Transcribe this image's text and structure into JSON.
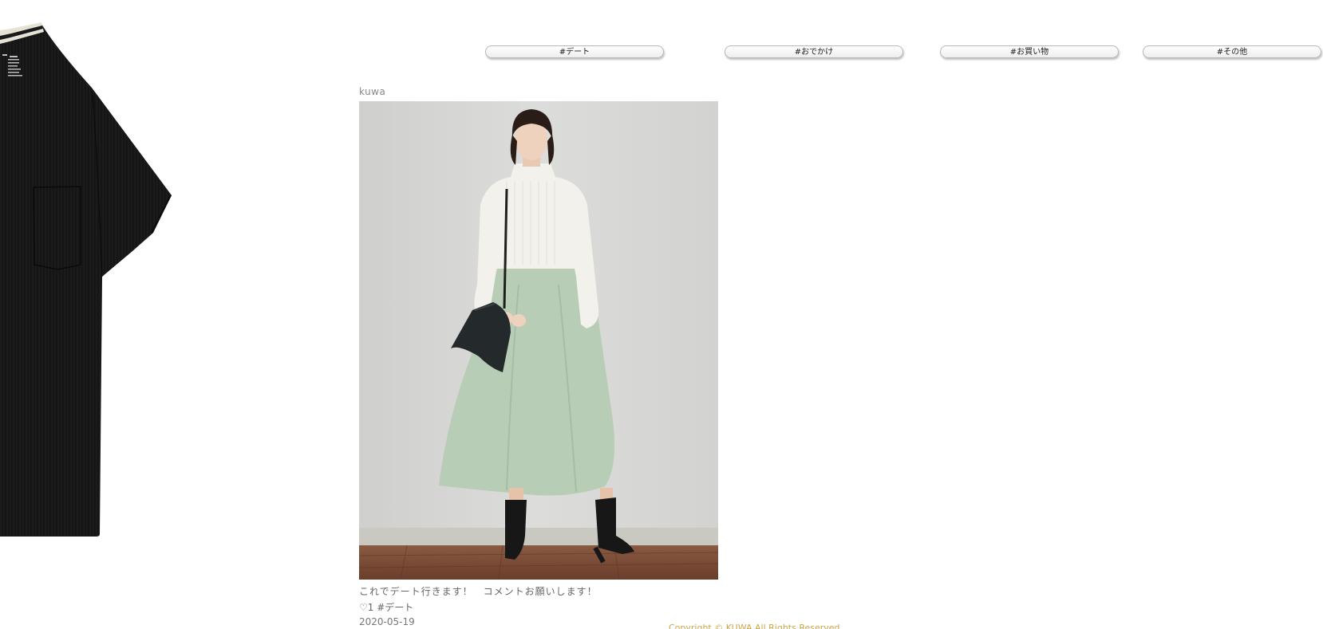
{
  "tags": {
    "date": "#デート",
    "outing": "#おでかけ",
    "shopping": "#お買い物",
    "other": "#その他"
  },
  "post": {
    "user": "kuwa",
    "caption": "これでデート行きます！　コメントお願いします！",
    "heart_icon": "♡",
    "likes": "1",
    "tag": "#デート",
    "date": "2020-05-19"
  },
  "footer": {
    "copyright": "Copyright © KUWA All Rights Reserved"
  },
  "colors": {
    "tshirt": "#141414",
    "photo_wall": "#d9d9d7",
    "sweater": "#f2f1ec",
    "skirt": "#b8cdb6",
    "floor": "#7a4a35",
    "copyright": "#c9a646"
  }
}
